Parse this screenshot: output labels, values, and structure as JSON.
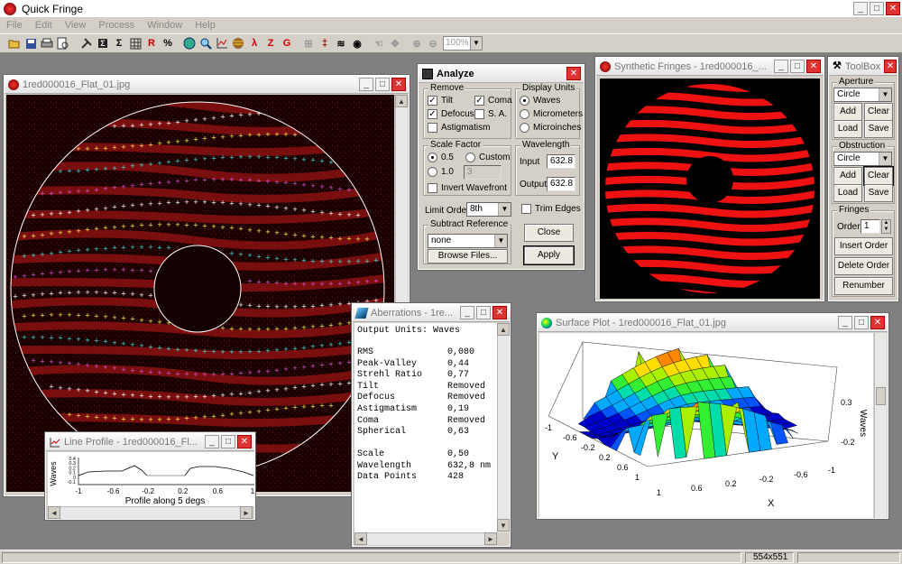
{
  "app": {
    "title": "Quick Fringe"
  },
  "window_buttons": {
    "minimize": "_",
    "maximize": "□",
    "close": "✕"
  },
  "menu": [
    "File",
    "Edit",
    "View",
    "Process",
    "Window",
    "Help"
  ],
  "toolbar": {
    "icons": [
      "open-icon",
      "save-icon",
      "print-icon",
      "print-preview-icon",
      "tools-icon",
      "sigma-icon",
      "grid-icon",
      "r-icon",
      "percent-icon",
      "aperture-icon",
      "zoom-fringe-icon",
      "plot-icon",
      "fringe-icon",
      "lambda-icon",
      "z-icon",
      "g-icon",
      "fringes-a-icon",
      "fringes-b-icon",
      "fringes-c-icon",
      "fringes-d-icon",
      "hand-icon",
      "pan-icon",
      "zoom-in-icon",
      "zoom-out-icon"
    ],
    "letters": {
      "r": "R",
      "pct": "%",
      "lambda": "λ",
      "z": "Z",
      "g": "G",
      "sigma": "Σ"
    },
    "zoom": "100%"
  },
  "image_window": {
    "title": "1red000016_Flat_01.jpg"
  },
  "analyze": {
    "title": "Analyze",
    "remove": {
      "label": "Remove",
      "tilt": "Tilt",
      "coma": "Coma",
      "defocus": "Defocus",
      "sa": "S. A.",
      "astigmatism": "Astigmatism",
      "tilt_checked": true,
      "coma_checked": true,
      "defocus_checked": true,
      "sa_checked": false,
      "astig_checked": false
    },
    "display_units": {
      "label": "Display Units",
      "options": [
        "Waves",
        "Micrometers",
        "Microinches"
      ],
      "selected": "Waves"
    },
    "scale_factor": {
      "label": "Scale Factor",
      "opt1": "0.5",
      "opt2": "Custom",
      "opt3": "1.0",
      "custom_value": "3",
      "invert": "Invert Wavefront",
      "selected": "0.5"
    },
    "wavelength": {
      "label": "Wavelength",
      "input_label": "Input",
      "input_value": "632.8",
      "output_label": "Output",
      "output_value": "632.8"
    },
    "limit_order": {
      "label": "Limit Order",
      "value": "8th"
    },
    "trim_edges": "Trim Edges",
    "subtract_reference": {
      "label": "Subtract Reference",
      "value": "none",
      "browse": "Browse Files..."
    },
    "close": "Close",
    "apply": "Apply"
  },
  "synthetic": {
    "title": "Synthetic Fringes - 1red000016_..."
  },
  "toolbox": {
    "title": "ToolBox",
    "aperture": {
      "label": "Aperture",
      "value": "Circle",
      "add": "Add",
      "clear": "Clear",
      "load": "Load",
      "save": "Save"
    },
    "obstruction": {
      "label": "Obstruction",
      "value": "Circle",
      "add": "Add",
      "clear": "Clear",
      "load": "Load",
      "save": "Save"
    },
    "fringes": {
      "label": "Fringes",
      "order_label": "Order",
      "order_value": "1",
      "insert": "Insert Order",
      "delete": "Delete Order",
      "renumber": "Renumber"
    }
  },
  "aberrations": {
    "title": "Aberrations - 1re...",
    "header": "Output Units: Waves",
    "rows": [
      {
        "label": "RMS",
        "value": "0,080"
      },
      {
        "label": "Peak-Valley",
        "value": "0,44"
      },
      {
        "label": "Strehl Ratio",
        "value": "0,77"
      },
      {
        "label": "Tilt",
        "value": "Removed"
      },
      {
        "label": "Defocus",
        "value": "Removed"
      },
      {
        "label": "Astigmatism",
        "value": "0,19"
      },
      {
        "label": "Coma",
        "value": "Removed"
      },
      {
        "label": "Spherical",
        "value": "0,63"
      }
    ],
    "rows2": [
      {
        "label": "Scale",
        "value": "0,50"
      },
      {
        "label": "Wavelength",
        "value": "632,8 nm"
      },
      {
        "label": "Data Points",
        "value": "428"
      }
    ]
  },
  "surface": {
    "title": "Surface Plot - 1red000016_Flat_01.jpg",
    "z_ticks": [
      "0.3",
      "-0.2"
    ],
    "z_label": "Waves",
    "y_ticks": [
      "-1",
      "-0.6",
      "-0.2",
      "0.2",
      "0.6",
      "1"
    ],
    "y_label": "Y",
    "x_ticks": [
      "1",
      "0.6",
      "0.2",
      "-0.2",
      "-0.6",
      "-1"
    ],
    "x_label": "X"
  },
  "line_profile": {
    "title": "Line Profile - 1red000016_Fl...",
    "ylabel": "Waves",
    "yticks": [
      "0.4",
      "0.3",
      "0.2",
      "0.1",
      "0",
      "-0.1"
    ],
    "xticks": [
      "-1",
      "-0.6",
      "-0.2",
      "0.2",
      "0.6",
      "1"
    ],
    "xlabel": "Profile along 5 degs"
  },
  "status": {
    "size": "554x551"
  }
}
